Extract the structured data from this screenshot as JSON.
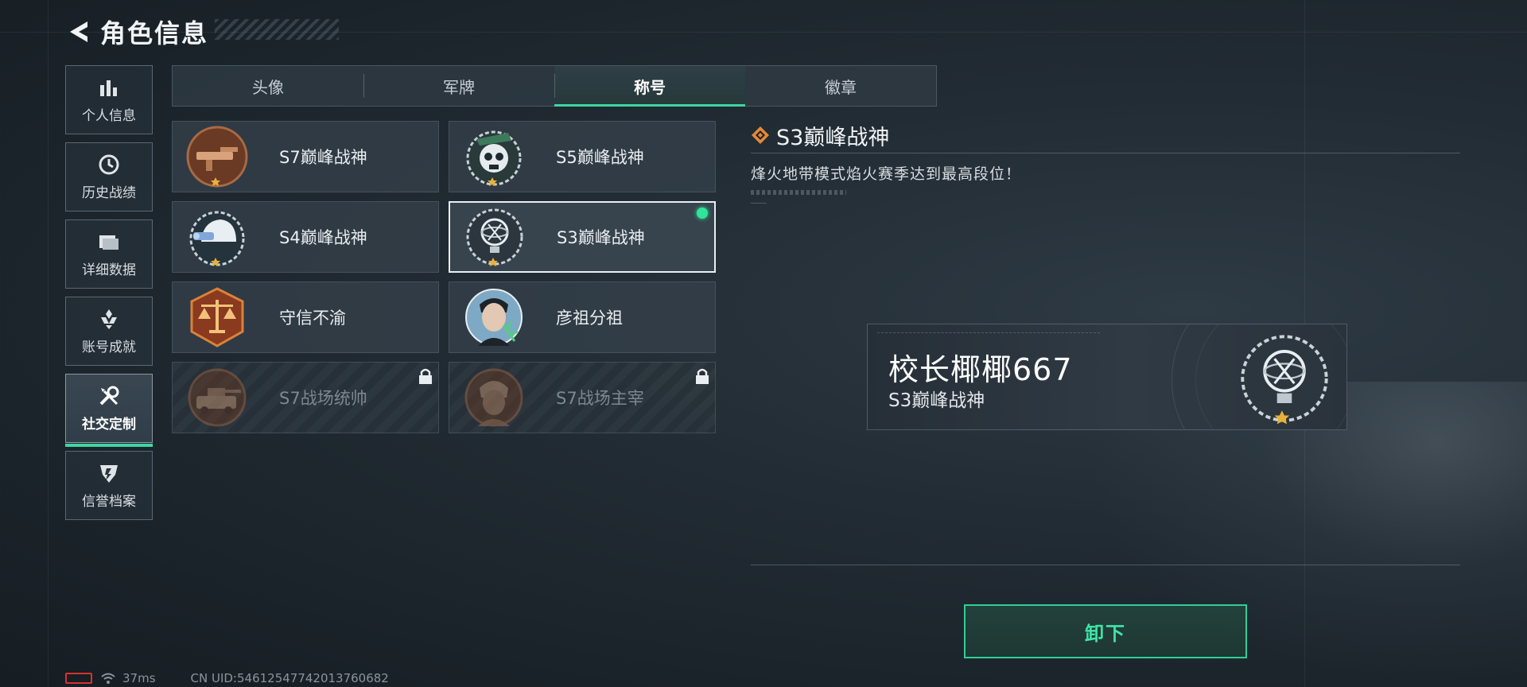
{
  "header": {
    "title": "角色信息"
  },
  "sidenav": [
    {
      "id": "personal",
      "label": "个人信息",
      "icon": "bar-chart-icon",
      "active": false
    },
    {
      "id": "history",
      "label": "历史战绩",
      "icon": "clock-icon",
      "active": false
    },
    {
      "id": "details",
      "label": "详细数据",
      "icon": "folder-icon",
      "active": false
    },
    {
      "id": "achievements",
      "label": "账号成就",
      "icon": "medal-icon",
      "active": false
    },
    {
      "id": "social",
      "label": "社交定制",
      "icon": "wrench-screwdriver-icon",
      "active": true
    },
    {
      "id": "credit",
      "label": "信誉档案",
      "icon": "shield-icon",
      "active": false
    }
  ],
  "tabs": [
    {
      "label": "头像",
      "active": false
    },
    {
      "label": "军牌",
      "active": false
    },
    {
      "label": "称号",
      "active": true
    },
    {
      "label": "徽章",
      "active": false
    }
  ],
  "titles": [
    {
      "name": "S7巅峰战神",
      "emblem": "gun-emblem",
      "state": "normal"
    },
    {
      "name": "S5巅峰战神",
      "emblem": "skull-emblem",
      "state": "normal"
    },
    {
      "name": "S4巅峰战神",
      "emblem": "helmet-emblem",
      "state": "normal"
    },
    {
      "name": "S3巅峰战神",
      "emblem": "globe-trophy-emblem",
      "state": "selected"
    },
    {
      "name": "守信不渝",
      "emblem": "scales-emblem",
      "state": "normal"
    },
    {
      "name": "彦祖分祖",
      "emblem": "portrait-emblem",
      "state": "normal"
    },
    {
      "name": "S7战场统帅",
      "emblem": "tank-emblem",
      "state": "locked"
    },
    {
      "name": "S7战场主宰",
      "emblem": "soldier-emblem",
      "state": "locked"
    }
  ],
  "detail": {
    "title": "S3巅峰战神",
    "description": "烽火地带模式焰火赛季达到最高段位！"
  },
  "preview": {
    "player_name": "校长椰椰667",
    "title": "S3巅峰战神"
  },
  "actions": {
    "unequip_label": "卸下"
  },
  "status": {
    "ping": "37ms",
    "uid": "CN UID:54612547742013760682"
  },
  "colors": {
    "accent": "#3ed6a0",
    "equipped": "#2fe59a",
    "battery": "#d8322f",
    "diamond": "#e58a3a"
  }
}
